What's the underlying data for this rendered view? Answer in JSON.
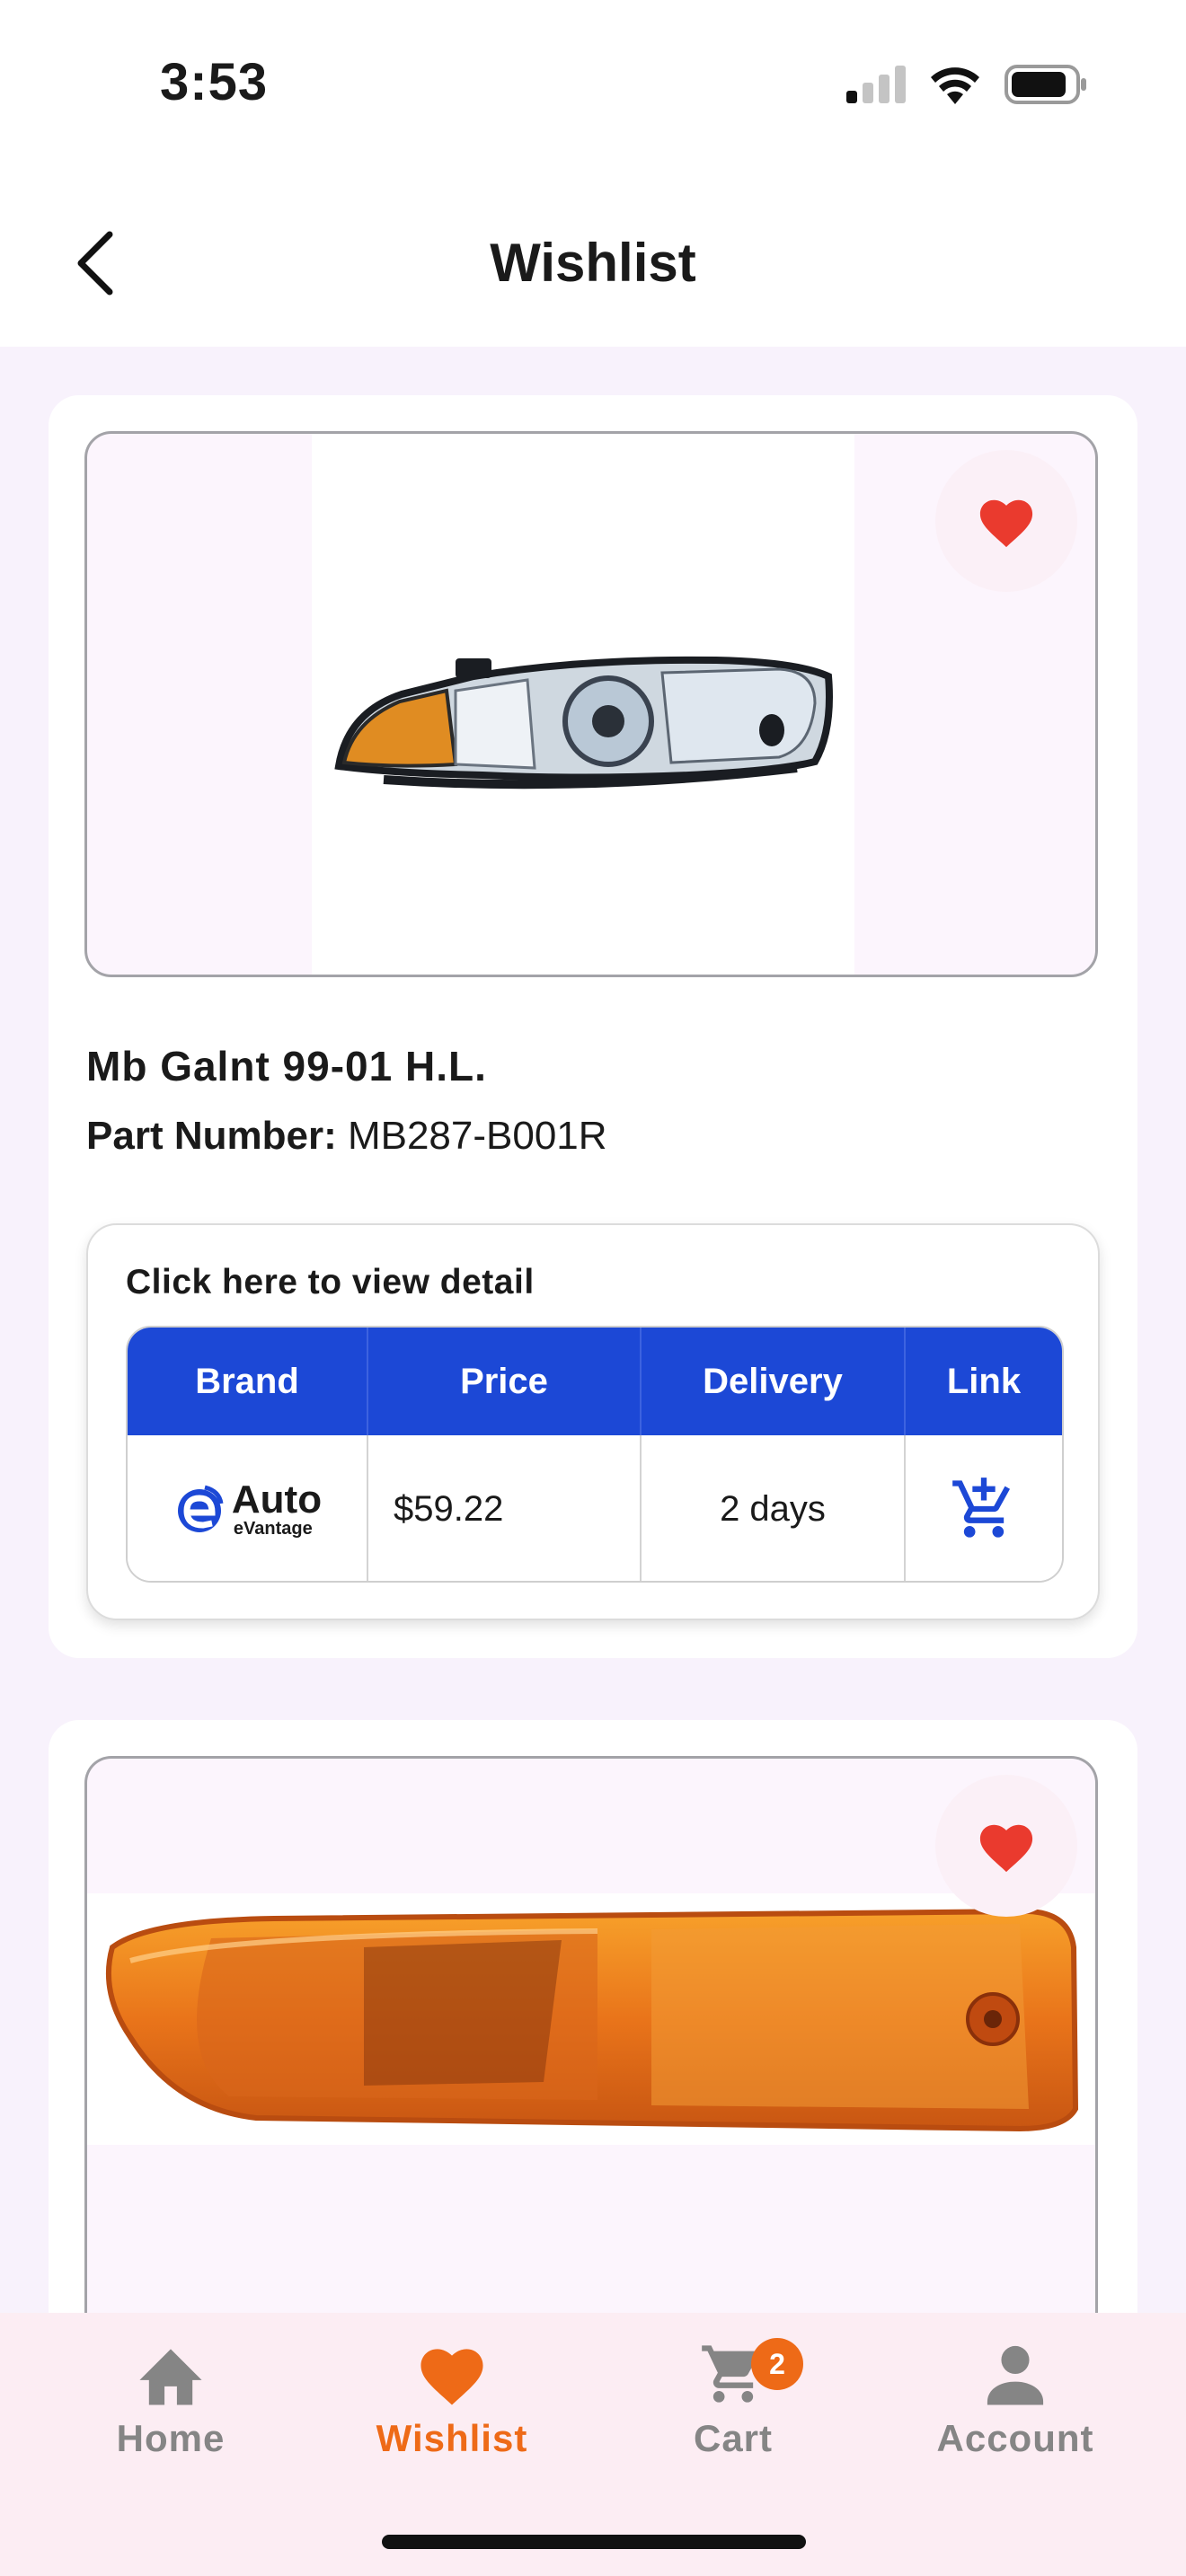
{
  "status_bar": {
    "time": "3:53"
  },
  "header": {
    "title": "Wishlist"
  },
  "products": [
    {
      "name": "Mb Galnt 99-01 H.L.",
      "part_number_label": "Part Number:",
      "part_number": "MB287-B001R",
      "detail_caption": "Click here to view detail",
      "table": {
        "headers": [
          "Brand",
          "Price",
          "Delivery",
          "Link"
        ],
        "row": {
          "brand_name": "Auto",
          "brand_sub": "eVantage",
          "price": "$59.22",
          "delivery": "2 days"
        }
      }
    },
    {
      "image": "amber-side-marker-lamp"
    }
  ],
  "bottom_nav": {
    "tabs": [
      {
        "label": "Home",
        "icon": "home-icon"
      },
      {
        "label": "Wishlist",
        "icon": "heart-icon",
        "active": true
      },
      {
        "label": "Cart",
        "icon": "cart-icon",
        "badge": "2"
      },
      {
        "label": "Account",
        "icon": "account-icon"
      }
    ]
  },
  "colors": {
    "accent": "#ee6a17",
    "table_header": "#1c48d6",
    "favorite": "#ea3a2e"
  }
}
